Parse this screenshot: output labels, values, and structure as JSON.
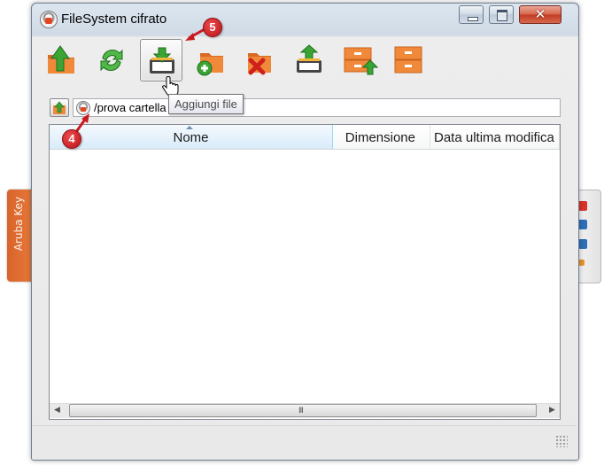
{
  "background_app": {
    "left_tab_label": "Aruba Key"
  },
  "window": {
    "title": "FileSystem cifrato",
    "close_glyph": "✕"
  },
  "toolbar": {
    "buttons": [
      {
        "icon": "folder-up-icon",
        "action": "up"
      },
      {
        "icon": "refresh-icon",
        "action": "refresh"
      },
      {
        "icon": "add-file-icon",
        "action": "add-file",
        "tooltip": "Aggiungi file",
        "active": true
      },
      {
        "icon": "new-folder-icon",
        "action": "new-folder"
      },
      {
        "icon": "delete-icon",
        "action": "delete"
      },
      {
        "icon": "extract-file-icon",
        "action": "extract-file"
      },
      {
        "icon": "import-archive-icon",
        "action": "import"
      },
      {
        "icon": "archive-icon",
        "action": "archive"
      }
    ]
  },
  "path_bar": {
    "path": "/prova cartella"
  },
  "tooltip": {
    "text": "Aggiungi file"
  },
  "file_list": {
    "columns": [
      "Nome",
      "Dimensione",
      "Data ultima modifica"
    ],
    "sort_column": "Nome",
    "rows": []
  },
  "scrollbar": {
    "grip": "III"
  },
  "annotations": {
    "step_5": "5",
    "step_4": "4",
    "color": "#c8191e"
  },
  "colors": {
    "close_button": "#c23b22",
    "icon_orange": "#e8742a",
    "icon_green": "#3aa534",
    "header_selected": "#d8ebfa"
  }
}
